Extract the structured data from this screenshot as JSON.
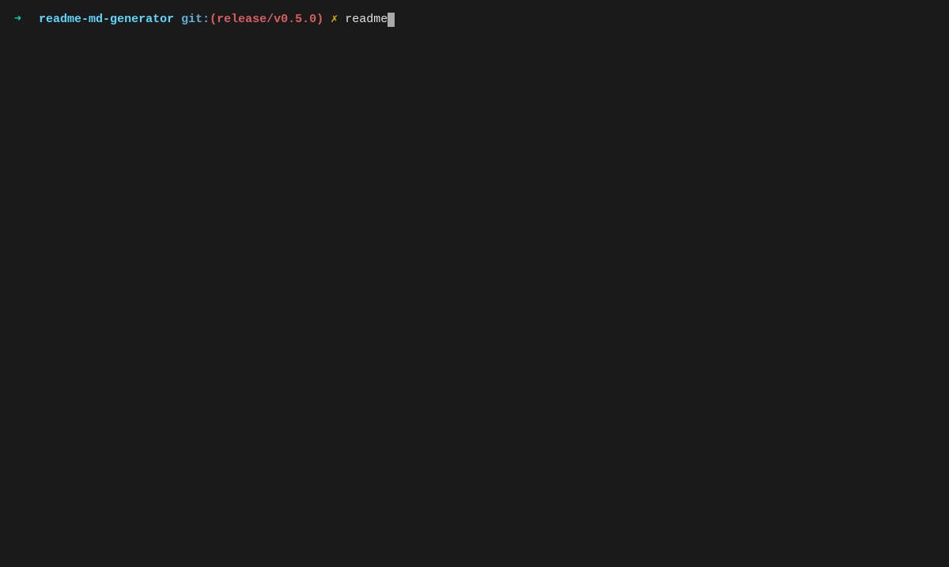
{
  "prompt": {
    "arrow": "➜",
    "directory": "readme-md-generator",
    "git_label": "git:",
    "paren_open": "(",
    "branch": "release/v0.5.0",
    "paren_close": ")",
    "dirty_marker": "✗",
    "command": "readme"
  }
}
